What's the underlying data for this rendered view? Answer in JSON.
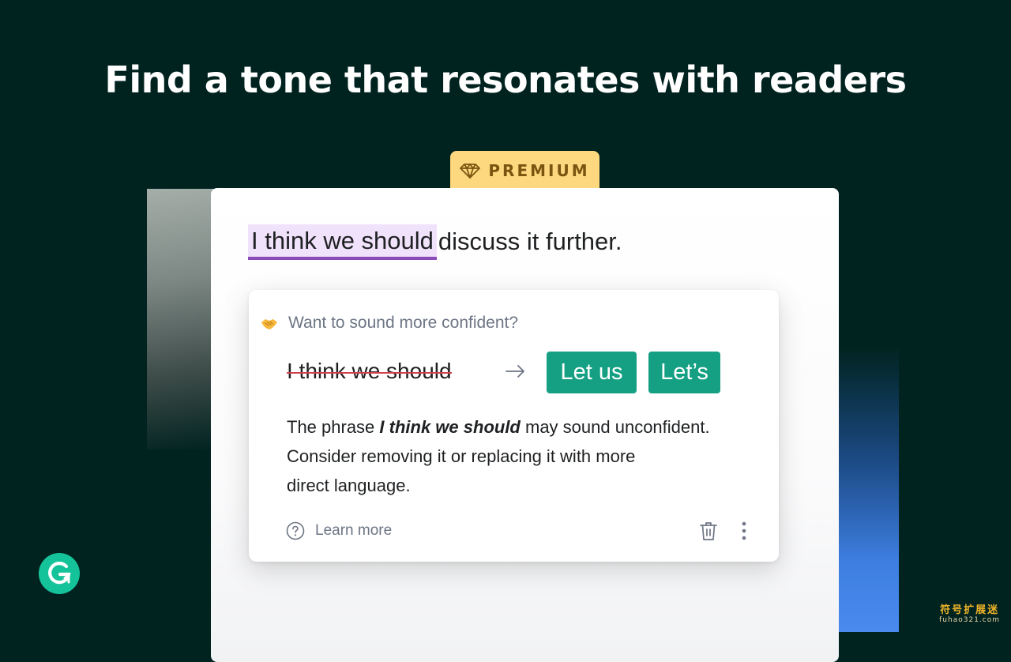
{
  "headline": "Find a tone that resonates with readers",
  "badge": {
    "label": "PREMIUM",
    "icon": "gem-icon",
    "color": "#fdd87f",
    "text_color": "#7a5510"
  },
  "editor": {
    "highlighted_phrase": "I think we should",
    "rest_of_sentence": "discuss it further.",
    "highlight_color": "#f1e2fc",
    "underline_color": "#8a4ab8"
  },
  "suggestion_card": {
    "icon": "handshake-icon",
    "question": "Want to sound more confident?",
    "original_phrase": "I think we should",
    "strike_color": "#d23f4b",
    "arrow_icon": "arrow-right-icon",
    "suggestions": [
      "Let us",
      "Let’s"
    ],
    "suggestion_color": "#15a083",
    "explanation_prefix": "The phrase",
    "explanation_phrase": "I think we should",
    "explanation_line1_rest": "may sound unconfident.",
    "explanation_line2": "Consider removing it or replacing it with more",
    "explanation_line3": "direct language.",
    "learn_more_label": "Learn more",
    "learn_more_icon": "question-circle-icon",
    "dismiss_icon": "trash-icon",
    "more_icon": "kebab-menu-icon"
  },
  "logo": {
    "icon": "grammarly-logo-icon",
    "color": "#15c39a"
  },
  "watermark": {
    "main": "符号扩展迷",
    "sub": "fuhao321.com"
  },
  "colors": {
    "background": "#012320",
    "card": "#ffffff",
    "muted_text": "#6d7585"
  }
}
